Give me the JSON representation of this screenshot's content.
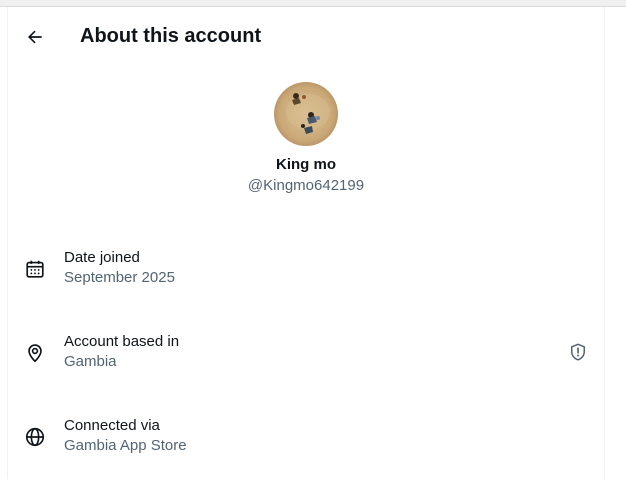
{
  "header": {
    "back_icon": "arrow-left-icon",
    "title": "About this account"
  },
  "profile": {
    "avatar_icon": "profile-photo",
    "name": "King mo",
    "handle": "@Kingmo642199"
  },
  "details": [
    {
      "icon": "calendar-icon",
      "label": "Date joined",
      "value": "September 2025"
    },
    {
      "icon": "location-pin-icon",
      "label": "Account based in",
      "value": "Gambia",
      "right_icon": "shield-alert-icon"
    },
    {
      "icon": "globe-icon",
      "label": "Connected via",
      "value": "Gambia App Store"
    }
  ],
  "colors": {
    "text_primary": "#0f1419",
    "text_secondary": "#536471",
    "border": "#eff3f4"
  }
}
